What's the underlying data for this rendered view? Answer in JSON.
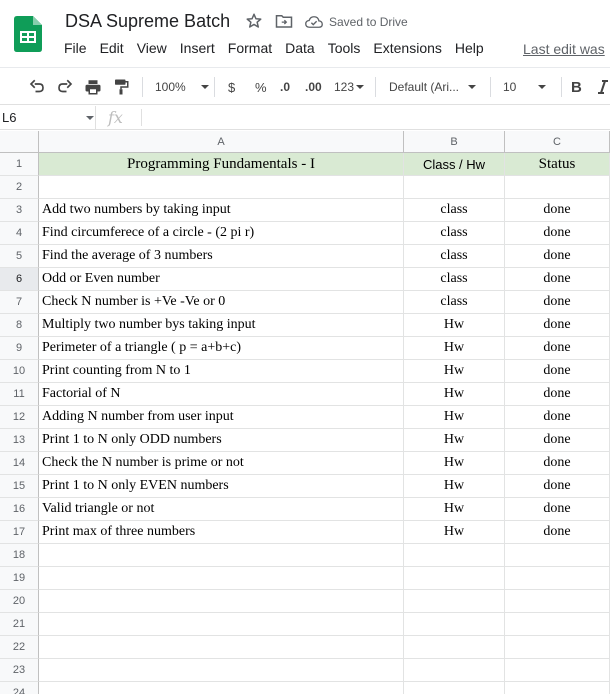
{
  "app": {
    "doc_title": "DSA Supreme Batch",
    "saved_status": "Saved to Drive",
    "last_edit": "Last edit was",
    "menu": [
      "File",
      "Edit",
      "View",
      "Insert",
      "Format",
      "Data",
      "Tools",
      "Extensions",
      "Help"
    ]
  },
  "toolbar": {
    "zoom": "100%",
    "currency": "$",
    "percent": "%",
    "decrease_decimal": ".0",
    "increase_decimal": ".00",
    "more_formats": "123",
    "font": "Default (Ari...",
    "font_size": "10",
    "bold": "B"
  },
  "formula_bar": {
    "cell_ref": "L6",
    "fx_label": "fx",
    "value": ""
  },
  "grid": {
    "columns": [
      "A",
      "B",
      "C"
    ],
    "header_fill": "#d9ead3",
    "selected_row": 6,
    "rows": [
      {
        "n": "1",
        "a": "Programming Fundamentals - I",
        "b": "Class /  Hw",
        "c": "Status"
      },
      {
        "n": "2",
        "a": "",
        "b": "",
        "c": ""
      },
      {
        "n": "3",
        "a": "Add two numbers by taking input",
        "b": "class",
        "c": "done"
      },
      {
        "n": "4",
        "a": "Find circumferece of a circle - (2 pi r)",
        "b": "class",
        "c": "done"
      },
      {
        "n": "5",
        "a": "Find the average of 3 numbers",
        "b": "class",
        "c": "done"
      },
      {
        "n": "6",
        "a": "Odd or Even number",
        "b": "class",
        "c": "done"
      },
      {
        "n": "7",
        "a": "Check N number is +Ve -Ve or 0",
        "b": "class",
        "c": "done"
      },
      {
        "n": "8",
        "a": "Multiply two number bys taking input",
        "b": "Hw",
        "c": "done"
      },
      {
        "n": "9",
        "a": "Perimeter of a triangle ( p = a+b+c)",
        "b": "Hw",
        "c": "done"
      },
      {
        "n": "10",
        "a": "Print counting from N to 1",
        "b": "Hw",
        "c": "done"
      },
      {
        "n": "11",
        "a": "Factorial of N",
        "b": "Hw",
        "c": "done"
      },
      {
        "n": "12",
        "a": "Adding N number from user input",
        "b": "Hw",
        "c": "done"
      },
      {
        "n": "13",
        "a": "Print 1 to N only ODD numbers",
        "b": "Hw",
        "c": "done"
      },
      {
        "n": "14",
        "a": "Check the N number is prime or not",
        "b": "Hw",
        "c": "done"
      },
      {
        "n": "15",
        "a": "Print 1 to N only EVEN numbers",
        "b": "Hw",
        "c": "done"
      },
      {
        "n": "16",
        "a": "Valid triangle or not",
        "b": "Hw",
        "c": "done"
      },
      {
        "n": "17",
        "a": "Print max of three numbers",
        "b": "Hw",
        "c": "done"
      },
      {
        "n": "18",
        "a": "",
        "b": "",
        "c": ""
      },
      {
        "n": "19",
        "a": "",
        "b": "",
        "c": ""
      },
      {
        "n": "20",
        "a": "",
        "b": "",
        "c": ""
      },
      {
        "n": "21",
        "a": "",
        "b": "",
        "c": ""
      },
      {
        "n": "22",
        "a": "",
        "b": "",
        "c": ""
      },
      {
        "n": "23",
        "a": "",
        "b": "",
        "c": ""
      },
      {
        "n": "24",
        "a": "",
        "b": "",
        "c": ""
      }
    ]
  }
}
